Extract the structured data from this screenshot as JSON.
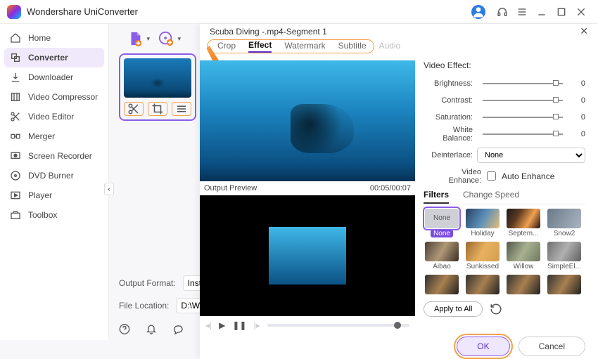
{
  "app": {
    "title": "Wondershare UniConverter"
  },
  "sidebar": {
    "items": [
      {
        "label": "Home"
      },
      {
        "label": "Converter"
      },
      {
        "label": "Downloader"
      },
      {
        "label": "Video Compressor"
      },
      {
        "label": "Video Editor"
      },
      {
        "label": "Merger"
      },
      {
        "label": "Screen Recorder"
      },
      {
        "label": "DVD Burner"
      },
      {
        "label": "Player"
      },
      {
        "label": "Toolbox"
      }
    ]
  },
  "footer": {
    "output_format_label": "Output Format:",
    "output_format_value": "Instagram H",
    "file_location_label": "File Location:",
    "file_location_value": "D:\\Wonder"
  },
  "modal": {
    "title": "Scuba Diving -.mp4-Segment 1",
    "tabs": [
      "Crop",
      "Effect",
      "Watermark",
      "Subtitle",
      "Audio"
    ],
    "active_tab": "Effect",
    "output_preview_label": "Output Preview",
    "time": "00:05/00:07",
    "effect": {
      "section_title": "Video Effect:",
      "brightness_label": "Brightness:",
      "brightness_value": "0",
      "contrast_label": "Contrast:",
      "contrast_value": "0",
      "saturation_label": "Saturation:",
      "saturation_value": "0",
      "wb_label": "White Balance:",
      "wb_value": "0",
      "deinterlace_label": "Deinterlace:",
      "deinterlace_value": "None",
      "enhance_label": "Video Enhance:",
      "enhance_check": "Auto Enhance"
    },
    "subtabs": {
      "filters": "Filters",
      "speed": "Change Speed"
    },
    "filters": [
      {
        "name": "None"
      },
      {
        "name": "Holiday"
      },
      {
        "name": "Septem..."
      },
      {
        "name": "Snow2"
      },
      {
        "name": "Aibao"
      },
      {
        "name": "Sunkissed"
      },
      {
        "name": "Willow"
      },
      {
        "name": "SimpleEl..."
      }
    ],
    "apply_all": "Apply to All",
    "ok": "OK",
    "cancel": "Cancel",
    "none_swatch_text": "None"
  }
}
